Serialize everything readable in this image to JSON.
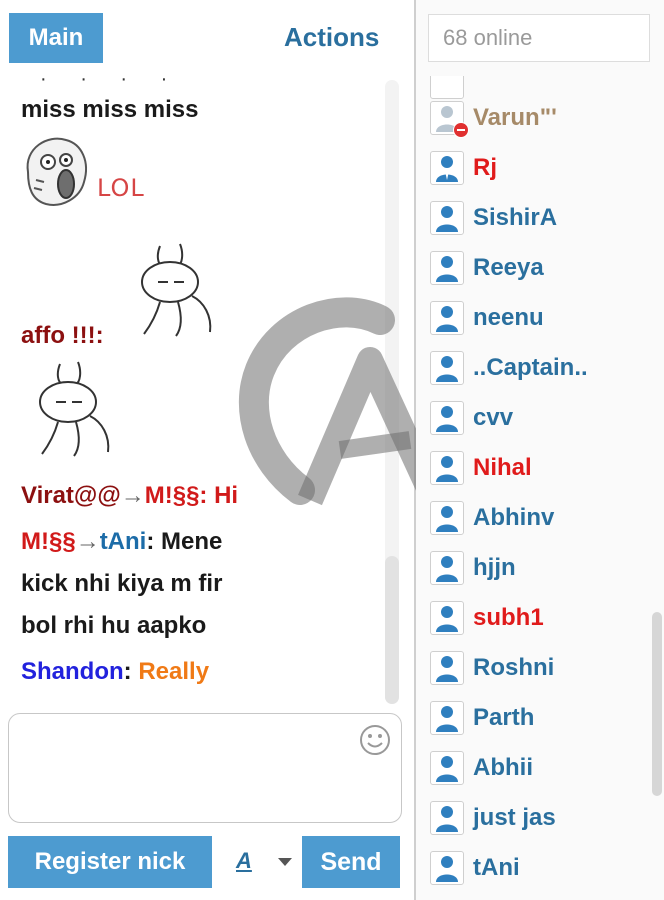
{
  "header": {
    "main_label": "Main",
    "actions_label": "Actions"
  },
  "messages": [
    {
      "text": "miss miss miss"
    },
    {
      "lol": "LOL"
    },
    {
      "text": "affo !!!:"
    },
    {
      "from": "Virat@@",
      "arrow": "→",
      "to": "M!§§",
      "sep": ":",
      "body": "Hi"
    },
    {
      "from": "M!§§",
      "arrow": "→",
      "to": "tAni",
      "sep": ":",
      "body_line1": "Mene",
      "body_line2": "kick nhi kiya m fir",
      "body_line3": "bol rhi hu aapko"
    },
    {
      "from": "Shandon",
      "sep": ":",
      "body": "Really"
    }
  ],
  "composer": {
    "register_label": "Register nick",
    "font_label": "A",
    "send_label": "Send"
  },
  "online": {
    "placeholder": "68 online"
  },
  "users": [
    {
      "name": "Varun\"'",
      "color": "#a68a68",
      "blocked": true
    },
    {
      "name": "Rj",
      "color": "#e01b1b",
      "icon": "user-suit-icon"
    },
    {
      "name": "SishirA",
      "color": "#2a6f9e"
    },
    {
      "name": "Reeya",
      "color": "#2a6f9e"
    },
    {
      "name": "neenu",
      "color": "#2a6f9e"
    },
    {
      "name": "..Captain..",
      "color": "#2a6f9e"
    },
    {
      "name": "cvv",
      "color": "#2a6f9e"
    },
    {
      "name": "Nihal",
      "color": "#e01b1b"
    },
    {
      "name": "Abhinv",
      "color": "#2a6f9e"
    },
    {
      "name": "hjjn",
      "color": "#2a6f9e"
    },
    {
      "name": "subh1",
      "color": "#e01b1b"
    },
    {
      "name": "Roshni",
      "color": "#2a6f9e"
    },
    {
      "name": "Parth",
      "color": "#2a6f9e"
    },
    {
      "name": "Abhii",
      "color": "#2a6f9e"
    },
    {
      "name": "just jas",
      "color": "#2a6f9e"
    },
    {
      "name": "tAni",
      "color": "#2a6f9e"
    }
  ],
  "colors": {
    "accent": "#4d9bd0",
    "link_blue": "#2a6f9e",
    "admin_red": "#e01b1b"
  }
}
